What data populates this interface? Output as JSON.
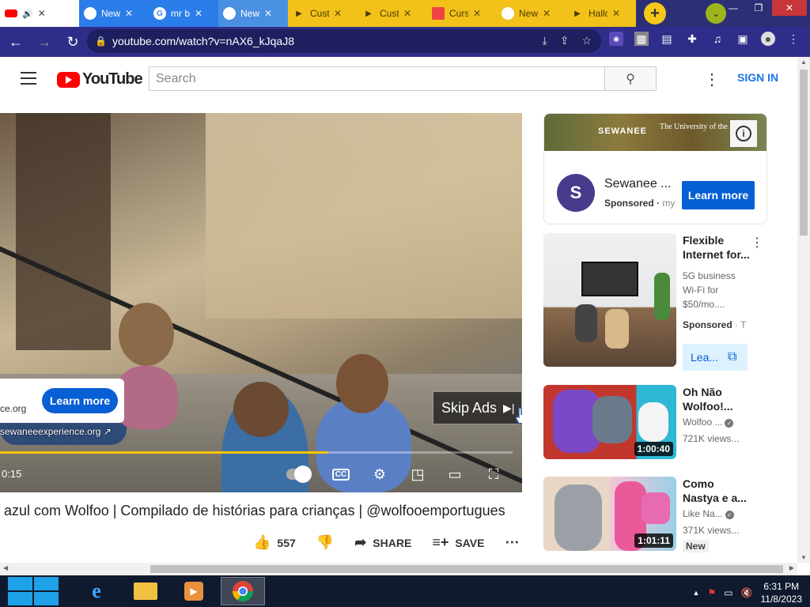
{
  "tabs": [
    {
      "title": "YouTube",
      "color": "#ffffff"
    },
    {
      "title": "New Tab",
      "color": "#2b7de9"
    },
    {
      "title": "mr b",
      "color": "#2b7de9"
    },
    {
      "title": "New Tab",
      "color": "#4a90e2"
    },
    {
      "title": "Cust",
      "color": "#f2c21b"
    },
    {
      "title": "Cust",
      "color": "#f2c21b"
    },
    {
      "title": "Curs",
      "color": "#f2c21b"
    },
    {
      "title": "New Tab",
      "color": "#f2c21b"
    },
    {
      "title": "Hallo",
      "color": "#f2c21b"
    }
  ],
  "toolbar": {
    "url": "youtube.com/watch?v=nAX6_kJqaJ8"
  },
  "header": {
    "logo_text": "YouTube",
    "search_placeholder": "Search",
    "signin": "SIGN IN"
  },
  "video": {
    "ad_domain_short": "ce.org",
    "ad_learn_more": "Learn more",
    "ad_url": "sewaneeexperience.org",
    "skip_label": "Skip Ads",
    "time": "0:15",
    "progress": 0.64
  },
  "below": {
    "title": "azul com Wolfoo | Compilado de histórias para crianças | @wolfooemportugues",
    "likes": "557",
    "share": "SHARE",
    "save": "SAVE"
  },
  "sponsor": {
    "banner_brand": "SEWANEE",
    "banner_university": "The University of the South",
    "name": "Sewanee ...",
    "sponsored": "Sponsored",
    "domain": "my",
    "button": "Learn more"
  },
  "sidebar": [
    {
      "title": "Flexible Internet for...",
      "meta": "5G business Wi-Fi for $50/mo....",
      "sponsored": "Sponsored",
      "channel": "T",
      "button": "Lea..."
    },
    {
      "title": "Oh Não Wolfoo!...",
      "channel": "Wolfoo ...",
      "views": "721K views...",
      "duration": "1:00:40"
    },
    {
      "title": "Como Nastya e a...",
      "channel": "Like Na...",
      "views": "371K views...",
      "duration": "1:01:11",
      "badge": "New"
    }
  ],
  "taskbar": {
    "time": "6:31 PM",
    "date": "11/8/2023"
  }
}
